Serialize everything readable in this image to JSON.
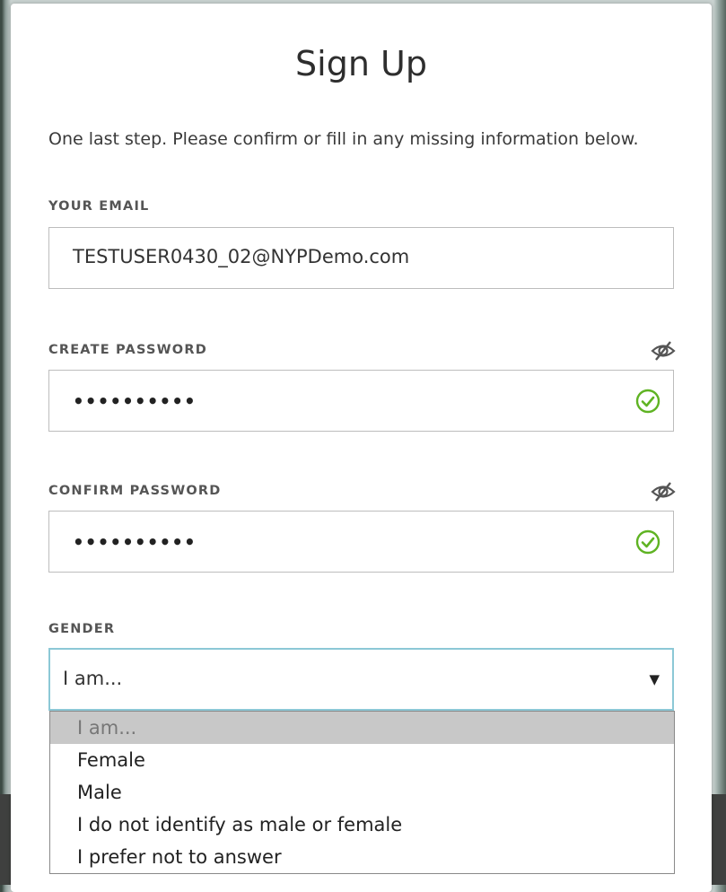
{
  "page": {
    "title": "Sign Up"
  },
  "intro": "One last step. Please confirm or fill in any missing information below.",
  "email": {
    "label": "YOUR EMAIL",
    "value": "TESTUSER0430_02@NYPDemo.com"
  },
  "create_password": {
    "label": "CREATE PASSWORD",
    "masked_value": "••••••••••"
  },
  "confirm_password": {
    "label": "CONFIRM PASSWORD",
    "masked_value": "••••••••••"
  },
  "gender": {
    "label": "GENDER",
    "value": "I am...",
    "options": [
      "I am...",
      "Female",
      "Male",
      "I do not identify as male or female",
      "I prefer not to answer"
    ]
  },
  "colors": {
    "valid": "#5fb323",
    "focus": "#8cc8d6"
  },
  "icons": {
    "visibility": "eye-slash-icon",
    "valid": "check-circle-icon",
    "dropdown": "caret-down-icon"
  }
}
